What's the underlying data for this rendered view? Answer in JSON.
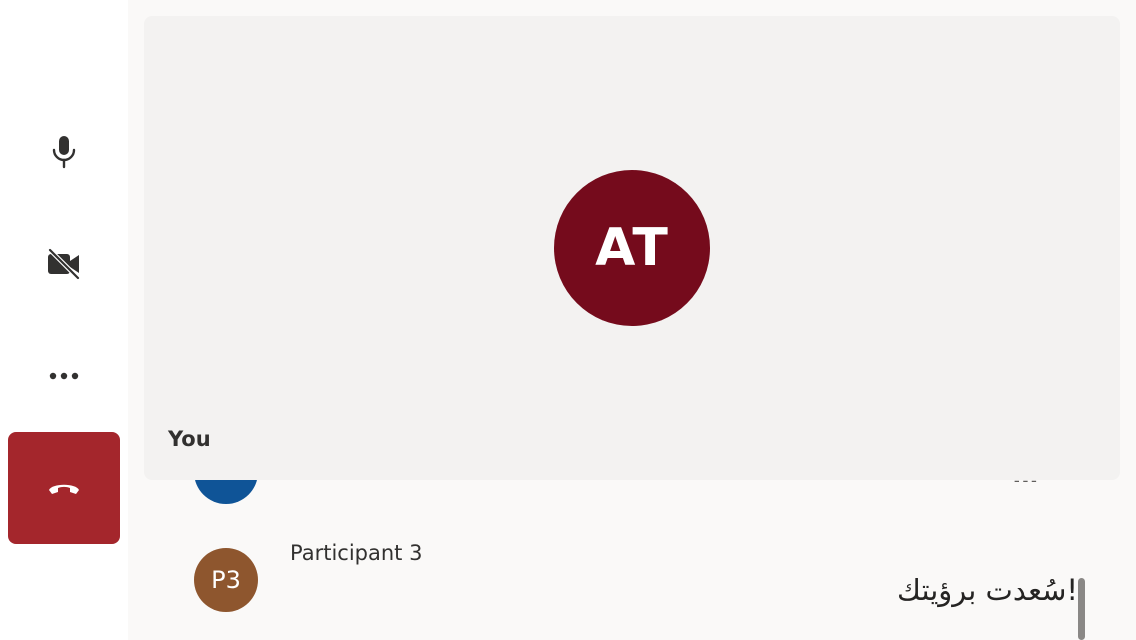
{
  "controls": {
    "microphone": {
      "icon": "microphone-icon"
    },
    "camera": {
      "icon": "video-off-icon",
      "state": "off"
    },
    "more": {
      "icon": "more-options-icon"
    },
    "hangup": {
      "icon": "hang-up-icon",
      "color": "#a4262c"
    }
  },
  "video_tile": {
    "avatar_initials": "AT",
    "avatar_color": "#750b1c",
    "name_label": "You"
  },
  "chat": {
    "messages": [
      {
        "avatar_color": "#0f5497",
        "text": "ـ ـ ـ"
      },
      {
        "sender": "Participant 3",
        "avatar_initials": "P3",
        "avatar_color": "#8e562e",
        "text": "!سُعدت برؤيتك"
      }
    ]
  }
}
